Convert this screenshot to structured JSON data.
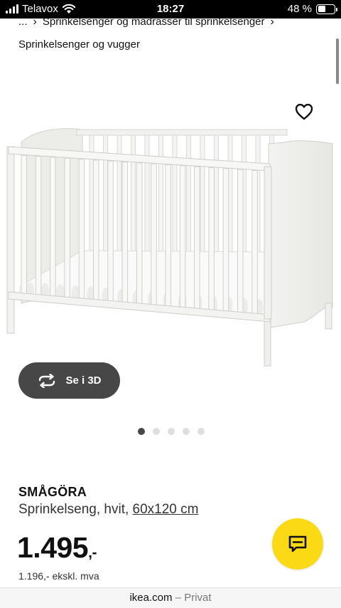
{
  "status_bar": {
    "carrier": "Telavox",
    "time": "18:27",
    "battery_percent": "48 %",
    "battery_level": 0.48
  },
  "breadcrumb": {
    "ellipsis": "...",
    "separator": "›",
    "item": "Sprinkelsenger og madrasser til sprinkelsenger"
  },
  "category_link": "Sprinkelsenger og vugger",
  "favorite_icon": "heart-outline-icon",
  "view_3d": {
    "label": "Se i 3D",
    "icon": "rotate-icon"
  },
  "carousel": {
    "total": 5,
    "active_index": 0
  },
  "product": {
    "name": "SMÅGÖRA",
    "description": "Sprinkelseng, hvit,",
    "size": "60x120 cm",
    "price": "1.495",
    "price_suffix": ",-",
    "price_excl_vat": "1.196,- ekskl. mva"
  },
  "chat": {
    "icon": "chat-bubble-icon",
    "color": "#fbd914"
  },
  "browser_bar": {
    "domain": "ikea.com",
    "separator": "–",
    "mode": "Privat"
  }
}
